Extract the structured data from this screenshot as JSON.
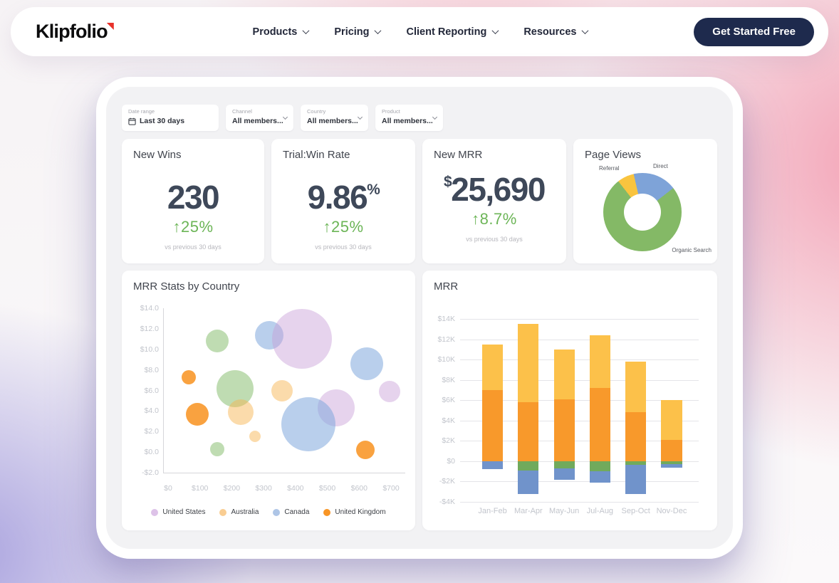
{
  "navbar": {
    "logo": "Klipfolio",
    "items": [
      {
        "label": "Products"
      },
      {
        "label": "Pricing"
      },
      {
        "label": "Client Reporting"
      },
      {
        "label": "Resources"
      }
    ],
    "cta_label": "Get Started Free",
    "cta_color": "#1e2a4d"
  },
  "filters": [
    {
      "label": "Date range",
      "value": "Last 30 days",
      "icon": "calendar-icon",
      "has_dropdown": false
    },
    {
      "label": "Channel",
      "value": "All members...",
      "has_dropdown": true
    },
    {
      "label": "Country",
      "value": "All members...",
      "has_dropdown": true
    },
    {
      "label": "Product",
      "value": "All members...",
      "has_dropdown": true
    }
  ],
  "kpis": [
    {
      "title": "New Wins",
      "prefix": "",
      "value": "230",
      "suffix": "",
      "delta": "↑25%",
      "note": "vs previous 30 days"
    },
    {
      "title": "Trial:Win Rate",
      "prefix": "",
      "value": "9.86",
      "suffix": "%",
      "delta": "↑25%",
      "note": "vs previous 30 days"
    },
    {
      "title": "New MRR",
      "prefix": "$",
      "value": "25,690",
      "suffix": "",
      "delta": "↑8.7%",
      "note": "vs previous 30 days"
    }
  ],
  "colors": {
    "delta_green": "#6cb557",
    "number_dark": "#3e4859"
  },
  "chart_data": [
    {
      "id": "page_views_donut",
      "type": "pie",
      "title": "Page Views",
      "hole_ratio": 0.47,
      "segments": [
        {
          "label": "Direct",
          "color": "#7ea3d8",
          "start_deg": -13,
          "end_deg": 52,
          "pct": 18
        },
        {
          "label": "Organic Search",
          "color": "#84b966",
          "start_deg": 52,
          "end_deg": 322,
          "pct": 75
        },
        {
          "label": "Referral",
          "color": "#f9c43f",
          "start_deg": 322,
          "end_deg": 347,
          "pct": 7
        }
      ]
    },
    {
      "id": "mrr_by_country",
      "type": "scatter",
      "title": "MRR Stats by Country",
      "x_ticks": [
        "$0",
        "$100",
        "$200",
        "$300",
        "$400",
        "$500",
        "$600",
        "$700"
      ],
      "y_ticks": [
        "$14.0",
        "$12.0",
        "$10.0",
        "$8.0",
        "$6.0",
        "$4.0",
        "$2.0",
        "$0.0",
        "-$2.0"
      ],
      "x_range": [
        0,
        700
      ],
      "y_range": [
        -2,
        14
      ],
      "series_colors": {
        "United States": "rgba(199,158,216,0.45)",
        "Australia": "rgba(246,179,80,0.48)",
        "Canada": "rgba(127,167,220,0.55)",
        "United Kingdom": "rgba(248,149,37,0.88)",
        "other": "rgba(127,185,101,0.50)"
      },
      "legend": [
        {
          "label": "United States",
          "color": "#ddc2e8"
        },
        {
          "label": "Australia",
          "color": "#f9cd92"
        },
        {
          "label": "Canada",
          "color": "#aec5e6"
        },
        {
          "label": "United Kingdom",
          "color": "#f89525"
        }
      ],
      "bubbles": [
        {
          "x": 155,
          "y": 10.8,
          "r": 16,
          "series": "other"
        },
        {
          "x": 318,
          "y": 11.4,
          "r": 20,
          "series": "Canada"
        },
        {
          "x": 420,
          "y": 11.0,
          "r": 42,
          "series": "United States"
        },
        {
          "x": 625,
          "y": 8.6,
          "r": 23,
          "series": "Canada"
        },
        {
          "x": 65,
          "y": 7.3,
          "r": 10,
          "series": "United Kingdom"
        },
        {
          "x": 210,
          "y": 6.2,
          "r": 26,
          "series": "other"
        },
        {
          "x": 358,
          "y": 6.0,
          "r": 15,
          "series": "Australia"
        },
        {
          "x": 695,
          "y": 5.9,
          "r": 15,
          "series": "United States"
        },
        {
          "x": 528,
          "y": 4.3,
          "r": 26,
          "series": "United States"
        },
        {
          "x": 92,
          "y": 3.7,
          "r": 16,
          "series": "United Kingdom"
        },
        {
          "x": 228,
          "y": 3.9,
          "r": 18,
          "series": "Australia"
        },
        {
          "x": 440,
          "y": 2.7,
          "r": 38,
          "series": "Canada"
        },
        {
          "x": 272,
          "y": 1.5,
          "r": 8,
          "series": "Australia"
        },
        {
          "x": 155,
          "y": 0.3,
          "r": 10,
          "series": "other"
        },
        {
          "x": 620,
          "y": 0.2,
          "r": 13,
          "series": "United Kingdom"
        }
      ]
    },
    {
      "id": "mrr_monthly",
      "type": "bar",
      "title": "MRR",
      "categories": [
        "Jan-Feb",
        "Mar-Apr",
        "May-Jun",
        "Jul-Aug",
        "Sep-Oct",
        "Nov-Dec"
      ],
      "y_ticks": [
        "$14K",
        "$12K",
        "$10K",
        "$8K",
        "$6K",
        "$4K",
        "$2K",
        "$0",
        "-$2K",
        "-$4K"
      ],
      "y_tick_values": [
        14,
        12,
        10,
        8,
        6,
        4,
        2,
        0,
        -2,
        -4
      ],
      "y_range": [
        -4,
        14
      ],
      "series_colors": {
        "yellow": "#fcc14a",
        "orange": "#f8992b",
        "green": "#71aa5c",
        "blue": "#7093cb"
      },
      "bars": [
        {
          "category": "Jan-Feb",
          "yellow": [
            7.0,
            11.5
          ],
          "orange": [
            0,
            7.0
          ],
          "green": [
            0,
            0
          ],
          "blue": [
            -0.8,
            0
          ]
        },
        {
          "category": "Mar-Apr",
          "yellow": [
            5.8,
            13.5
          ],
          "orange": [
            0,
            5.8
          ],
          "green": [
            -0.9,
            0
          ],
          "blue": [
            -3.2,
            -0.9
          ]
        },
        {
          "category": "May-Jun",
          "yellow": [
            6.1,
            11.0
          ],
          "orange": [
            0,
            6.1
          ],
          "green": [
            -0.7,
            0
          ],
          "blue": [
            -1.8,
            -0.7
          ]
        },
        {
          "category": "Jul-Aug",
          "yellow": [
            7.2,
            12.4
          ],
          "orange": [
            0,
            7.2
          ],
          "green": [
            -1.0,
            0
          ],
          "blue": [
            -2.1,
            -1.0
          ]
        },
        {
          "category": "Sep-Oct",
          "yellow": [
            4.8,
            9.8
          ],
          "orange": [
            0,
            4.8
          ],
          "green": [
            -0.35,
            0
          ],
          "blue": [
            -3.25,
            -0.35
          ]
        },
        {
          "category": "Nov-Dec",
          "yellow": [
            2.1,
            6.0
          ],
          "orange": [
            0,
            2.1
          ],
          "green": [
            -0.3,
            0
          ],
          "blue": [
            -0.65,
            -0.3
          ]
        }
      ]
    }
  ]
}
